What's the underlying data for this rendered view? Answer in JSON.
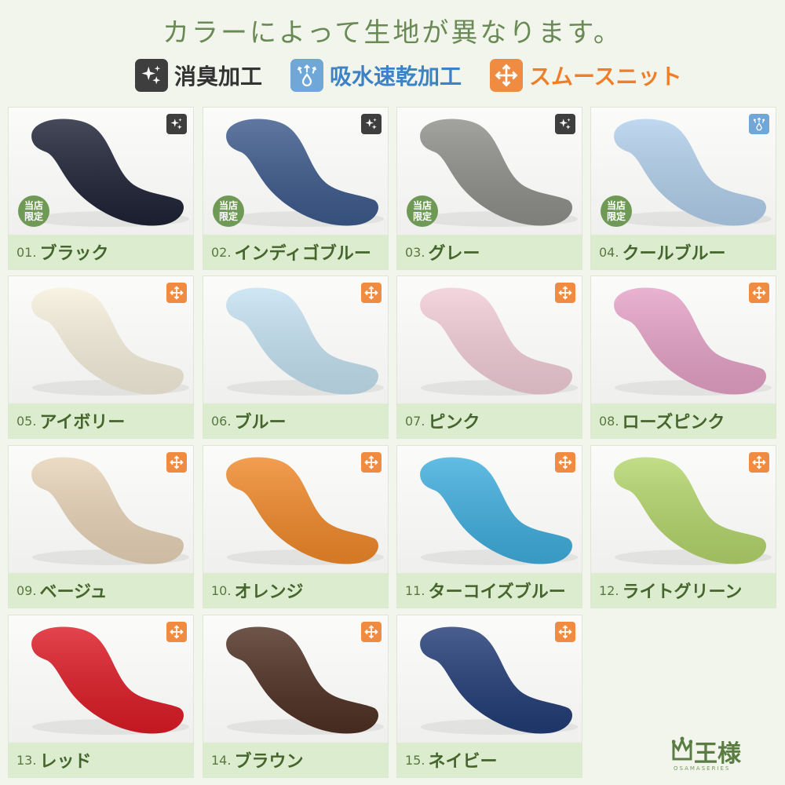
{
  "title": "カラーによって生地が異なります。",
  "legend": [
    {
      "icon": "sparkle-icon",
      "label": "消臭加工",
      "bg": "#3e3e3e",
      "color": "#333333"
    },
    {
      "icon": "quick-dry-icon",
      "label": "吸水速乾加工",
      "bg": "#6ea7d8",
      "color": "#3e82c6"
    },
    {
      "icon": "stretch-arrows-icon",
      "label": "スムースニット",
      "bg": "#ef8c42",
      "color": "#ee7e2a"
    }
  ],
  "shop_badge": [
    "当店",
    "限定"
  ],
  "colors": [
    {
      "num": "01.",
      "name": "ブラック",
      "swatch": "#1e2235",
      "badge": "sparkle-icon",
      "shop_limited": true
    },
    {
      "num": "02.",
      "name": "インディゴブルー",
      "swatch": "#3d5a8c",
      "badge": "sparkle-icon",
      "shop_limited": true
    },
    {
      "num": "03.",
      "name": "グレー",
      "swatch": "#8f8f8b",
      "badge": "sparkle-icon",
      "shop_limited": true
    },
    {
      "num": "04.",
      "name": "クールブルー",
      "swatch": "#b2d0ec",
      "badge": "quick-dry-icon",
      "shop_limited": true
    },
    {
      "num": "05.",
      "name": "アイボリー",
      "swatch": "#f6f0dd",
      "badge": "stretch-arrows-icon",
      "shop_limited": false
    },
    {
      "num": "06.",
      "name": "ブルー",
      "swatch": "#c5e2f2",
      "badge": "stretch-arrows-icon",
      "shop_limited": false
    },
    {
      "num": "07.",
      "name": "ピンク",
      "swatch": "#f2cdd8",
      "badge": "stretch-arrows-icon",
      "shop_limited": false
    },
    {
      "num": "08.",
      "name": "ローズピンク",
      "swatch": "#e6a2c7",
      "badge": "stretch-arrows-icon",
      "shop_limited": false
    },
    {
      "num": "09.",
      "name": "ベージュ",
      "swatch": "#e8d4b8",
      "badge": "stretch-arrows-icon",
      "shop_limited": false
    },
    {
      "num": "10.",
      "name": "オレンジ",
      "swatch": "#f0892a",
      "badge": "stretch-arrows-icon",
      "shop_limited": false
    },
    {
      "num": "11.",
      "name": "ターコイズブルー",
      "swatch": "#40aede",
      "badge": "stretch-arrows-icon",
      "shop_limited": false
    },
    {
      "num": "12.",
      "name": "ライトグリーン",
      "swatch": "#b4d66c",
      "badge": "stretch-arrows-icon",
      "shop_limited": false
    },
    {
      "num": "13.",
      "name": "レッド",
      "swatch": "#dd1b26",
      "badge": "stretch-arrows-icon",
      "shop_limited": false
    },
    {
      "num": "14.",
      "name": "ブラウン",
      "swatch": "#4f3023",
      "badge": "stretch-arrows-icon",
      "shop_limited": false
    },
    {
      "num": "15.",
      "name": "ネイビー",
      "swatch": "#223c76",
      "badge": "stretch-arrows-icon",
      "shop_limited": false
    }
  ],
  "logo": {
    "text": "王様",
    "sub": "OSAMASERIES"
  }
}
